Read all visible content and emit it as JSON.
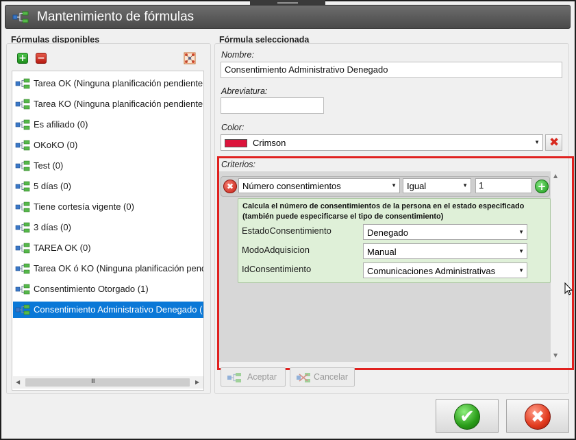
{
  "window": {
    "title": "Mantenimiento de fórmulas"
  },
  "left_panel": {
    "heading": "Fórmulas disponibles",
    "toolbar": {
      "add_symbol": "+",
      "remove_symbol": "−",
      "icons": [
        "add-icon",
        "remove-icon",
        "network-icon"
      ]
    },
    "items": [
      {
        "label": "Tarea OK (Ninguna planificación pendiente",
        "selected": false
      },
      {
        "label": "Tarea KO (Ninguna planificación pendiente",
        "selected": false
      },
      {
        "label": "Es afiliado (0)",
        "selected": false
      },
      {
        "label": "OKoKO (0)",
        "selected": false
      },
      {
        "label": "Test (0)",
        "selected": false
      },
      {
        "label": "5 días (0)",
        "selected": false
      },
      {
        "label": "Tiene cortesía vigente (0)",
        "selected": false
      },
      {
        "label": "3 días (0)",
        "selected": false
      },
      {
        "label": "TAREA OK (0)",
        "selected": false
      },
      {
        "label": "Tarea OK ó KO (Ninguna planificación pend",
        "selected": false
      },
      {
        "label": "Consentimiento Otorgado (1)",
        "selected": false
      },
      {
        "label": "Consentimiento Administrativo Denegado (",
        "selected": true
      }
    ],
    "hscroll_grip": "III"
  },
  "right_panel": {
    "heading": "Fórmula seleccionada",
    "name_label": "Nombre:",
    "name_value": "Consentimiento Administrativo Denegado",
    "abbrev_label": "Abreviatura:",
    "abbrev_value": "",
    "color_label": "Color:",
    "color_value": "Crimson",
    "color_hex": "#DC143C",
    "criteria_label": "Criterios:",
    "criteria": {
      "function": "Número consentimientos",
      "operator": "Igual",
      "value": "1",
      "remove_symbol": "✖",
      "add_symbol": "+",
      "description": "Calcula el número de consentimientos de la persona en el estado especificado (también puede especificarse el tipo de consentimiento)",
      "params": [
        {
          "label": "EstadoConsentimiento",
          "value": "Denegado"
        },
        {
          "label": "ModoAdquisicion",
          "value": "Manual"
        },
        {
          "label": "IdConsentimiento",
          "value": "Comunicaciones Administrativas"
        }
      ]
    },
    "accept_label": "Aceptar",
    "cancel_label": "Cancelar"
  },
  "footer": {
    "ok_symbol": "✔",
    "cancel_symbol": "✖"
  },
  "colors": {
    "highlight_border": "#E0211F",
    "selection": "#0A78D7",
    "detail_bg": "#DFF0D8"
  }
}
